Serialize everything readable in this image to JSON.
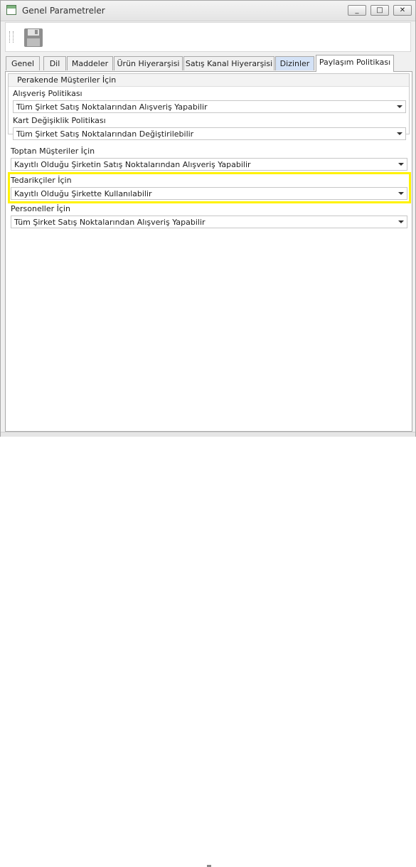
{
  "window": {
    "title": "Genel Parametreler",
    "minimize_glyph": "_",
    "maximize_glyph": "□",
    "close_glyph": "✕"
  },
  "toolbar": {
    "save_icon": "floppy-disk-icon"
  },
  "tabs": [
    {
      "label": "Genel"
    },
    {
      "label": "Dil"
    },
    {
      "label": "Maddeler"
    },
    {
      "label": "Ürün Hiyerarşisi"
    },
    {
      "label": "Satış Kanal Hiyerarşisi"
    },
    {
      "label": "Dizinler"
    },
    {
      "label": "Paylaşım Politikası"
    }
  ],
  "active_tab": "Paylaşım Politikası",
  "retail": {
    "header": "Perakende Müşteriler İçin",
    "shopping_label": "Alışveriş Politikası",
    "shopping_value": "Tüm Şirket Satış Noktalarından Alışveriş Yapabilir",
    "card_label": "Kart Değişiklik Politikası",
    "card_value": "Tüm Şirket Satış Noktalarından Değiştirilebilir"
  },
  "wholesale": {
    "label": "Toptan Müşteriler İçin",
    "value": "Kayıtlı Olduğu Şirketin Satış Noktalarından Alışveriş Yapabilir"
  },
  "suppliers": {
    "label": "Tedarikçiler İçin",
    "value": "Kayıtlı Olduğu Şirkette Kullanılabilir"
  },
  "personnel": {
    "label": "Personeller İçin",
    "value": "Tüm Şirket Satış Noktalarından Alışveriş Yapabilir"
  },
  "colors": {
    "highlight": "#fff200",
    "tab_blue": "#d4e2f6"
  }
}
